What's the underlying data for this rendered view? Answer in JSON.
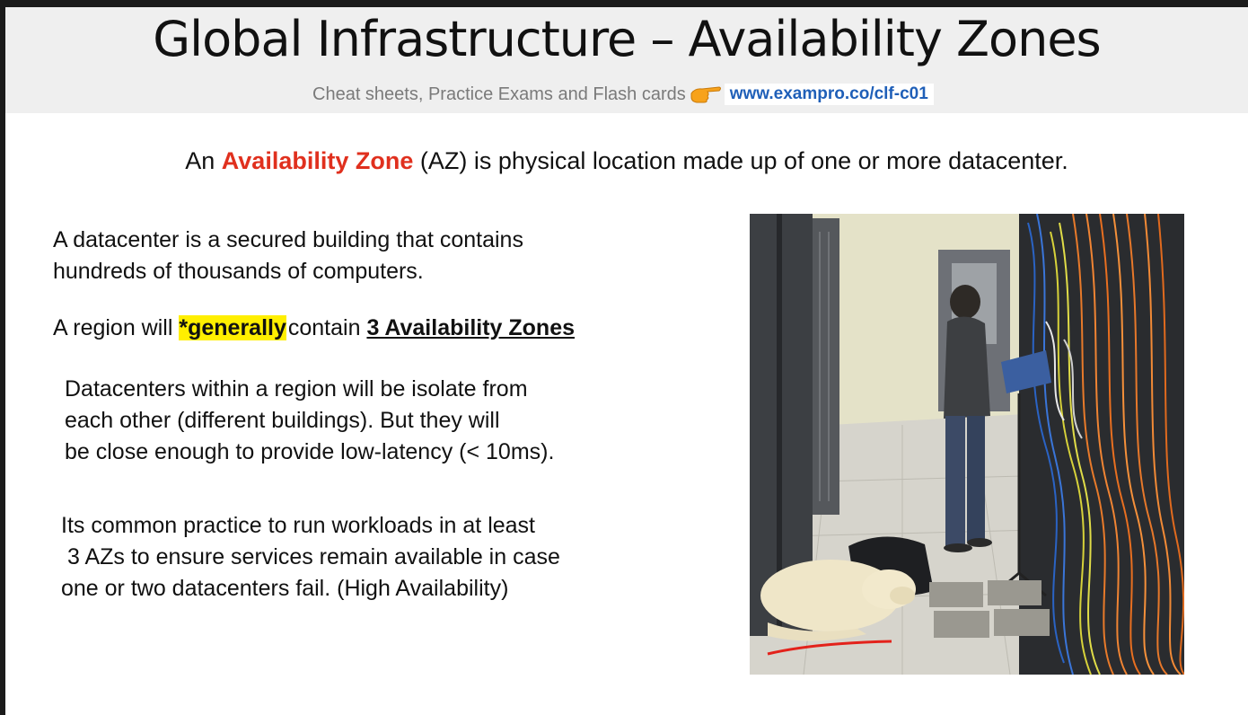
{
  "slide": {
    "title": "Global Infrastructure – Availability Zones",
    "subtitle": "Cheat sheets, Practice Exams and Flash cards",
    "link": "www.exampro.co/clf-c01",
    "icons": {
      "hand": "pointing-hand-icon"
    }
  },
  "intro": {
    "prefix": "An",
    "term": "Availability Zone",
    "suffix": "(AZ) is physical location made up of one or more datacenter."
  },
  "points": {
    "datacenter": [
      "A datacenter is a secured building that contains",
      "hundreds of thousands of computers."
    ],
    "region_prefix": "A region will",
    "region_highlight": "*generally",
    "region_middle": "contain",
    "region_emphasis": "3 Availability Zones",
    "isolation": [
      "Datacenters within a region will be isolate from",
      "each other (different buildings). But they will",
      "be close enough to provide low-latency (< 10ms)."
    ],
    "practice": [
      "Its common practice to run workloads in at least",
      "3 AZs to ensure services remain available in case",
      "one or two datacenters fail. (High Availability)"
    ]
  },
  "colors": {
    "accent_red": "#e0301e",
    "highlight_yellow": "#ffef00",
    "link_blue": "#1f5fb8"
  },
  "image": {
    "subject": "datacenter-server-room-photo"
  }
}
